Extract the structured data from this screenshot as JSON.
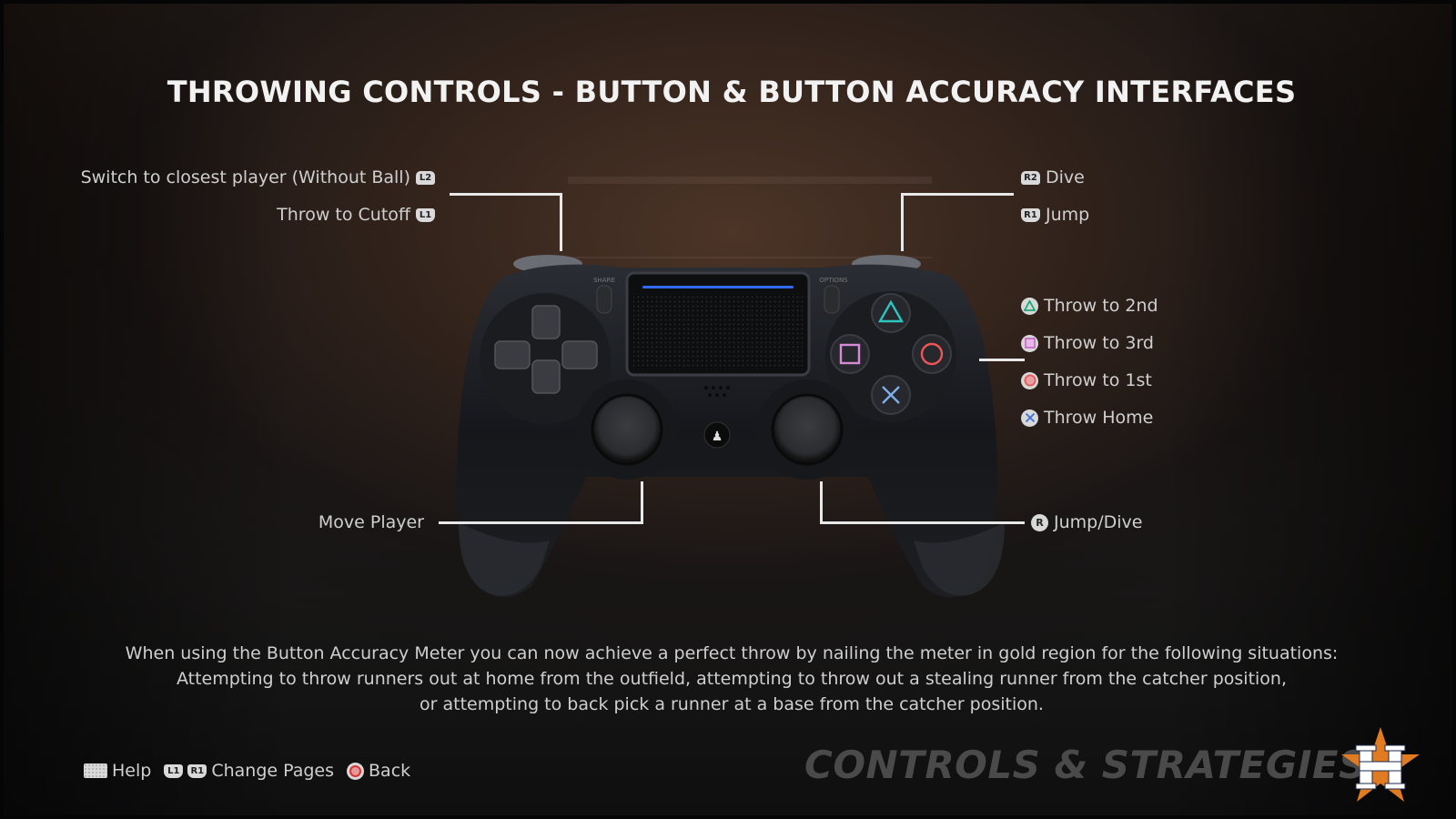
{
  "page": {
    "title": "THROWING CONTROLS - BUTTON & BUTTON ACCURACY INTERFACES"
  },
  "controller": {
    "share_label": "SHARE",
    "options_label": "OPTIONS",
    "lightbar_color": "#2f6bff"
  },
  "mappings": {
    "left": [
      {
        "label": "Switch to closest player (Without Ball)",
        "button": "L2"
      },
      {
        "label": "Throw to Cutoff",
        "button": "L1"
      },
      {
        "label": "Move Player",
        "button": "Left Stick"
      }
    ],
    "right": [
      {
        "label": "Dive",
        "button": "R2"
      },
      {
        "label": "Jump",
        "button": "R1"
      },
      {
        "label": "Throw to 2nd",
        "button": "triangle"
      },
      {
        "label": "Throw to 3rd",
        "button": "square"
      },
      {
        "label": "Throw to 1st",
        "button": "circle"
      },
      {
        "label": "Throw Home",
        "button": "cross"
      },
      {
        "label": "Jump/Dive",
        "button": "R"
      }
    ]
  },
  "description": {
    "lines": [
      "When using the Button Accuracy Meter you can now achieve a perfect throw by nailing the meter in gold region for the following situations:",
      "Attempting to throw runners out at home from the outfield, attempting to throw out a stealing runner from the catcher position,",
      "or attempting to back pick a runner at a base from the catcher position."
    ]
  },
  "footer": {
    "help_label": "Help",
    "l1": "L1",
    "r1": "R1",
    "change_pages_label": "Change Pages",
    "back_label": "Back"
  },
  "branding": {
    "section_title": "CONTROLS & STRATEGIES",
    "team_logo": "H",
    "logo_star_color": "#e07b22",
    "logo_letter_color": "#ffffff"
  },
  "colors": {
    "triangle": "#1aa877",
    "square": "#c466c4",
    "circle": "#e05a5a",
    "cross": "#3a6fe0"
  }
}
